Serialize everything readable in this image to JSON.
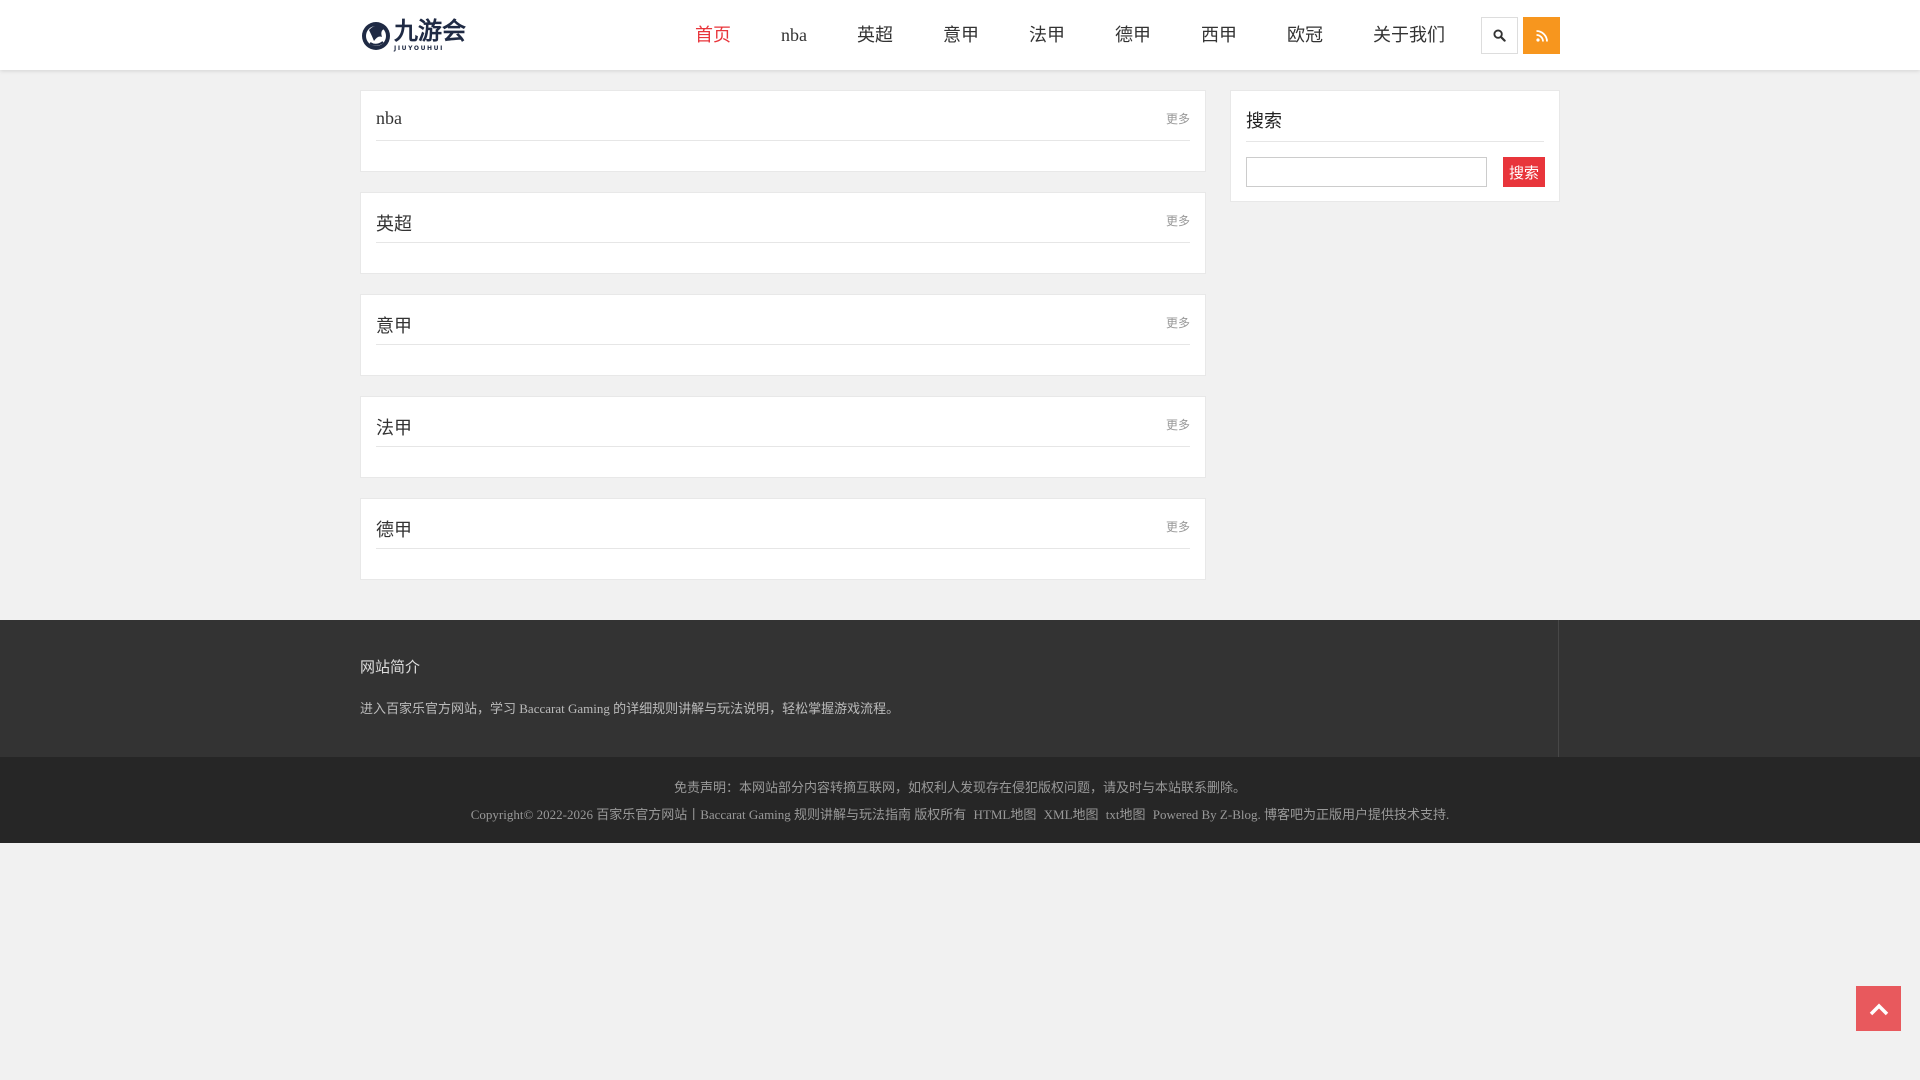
{
  "brand": {
    "logo_cn": "九游会",
    "logo_en": "JIUYOUHUI"
  },
  "nav": {
    "items": [
      {
        "label": "首页",
        "active": true
      },
      {
        "label": "nba",
        "active": false
      },
      {
        "label": "英超",
        "active": false
      },
      {
        "label": "意甲",
        "active": false
      },
      {
        "label": "法甲",
        "active": false
      },
      {
        "label": "德甲",
        "active": false
      },
      {
        "label": "西甲",
        "active": false
      },
      {
        "label": "欧冠",
        "active": false
      },
      {
        "label": "关于我们",
        "active": false
      }
    ],
    "search_icon": "search-icon",
    "rss_icon": "rss-icon"
  },
  "sections": [
    {
      "title": "nba",
      "more": "更多"
    },
    {
      "title": "英超",
      "more": "更多"
    },
    {
      "title": "意甲",
      "more": "更多"
    },
    {
      "title": "法甲",
      "more": "更多"
    },
    {
      "title": "德甲",
      "more": "更多"
    }
  ],
  "sidebar": {
    "search_title": "搜索",
    "search_value": "",
    "search_button": "搜索"
  },
  "footer": {
    "about_title": "网站简介",
    "about_text": "进入百家乐官方网站，学习 Baccarat Gaming 的详细规则讲解与玩法说明，轻松掌握游戏流程。",
    "disclaimer": "免责声明：本网站部分内容转摘互联网，如权利人发现存在侵犯版权问题，请及时与本站联系删除。",
    "copyright": "Copyright© 2022-2026 百家乐官方网站丨Baccarat Gaming 规则讲解与玩法指南 版权所有",
    "links": [
      "HTML地图",
      "XML地图",
      "txt地图"
    ],
    "powered": "Powered By Z-Blog. 博客吧为正版用户提供技术支持."
  },
  "colors": {
    "accent": "#e8353b",
    "rss": "#f7961e",
    "back_top": "#e8595d",
    "footer_top": "#333333",
    "footer_bottom": "#262626"
  },
  "back_to_top_icon": "chevron-up-icon"
}
